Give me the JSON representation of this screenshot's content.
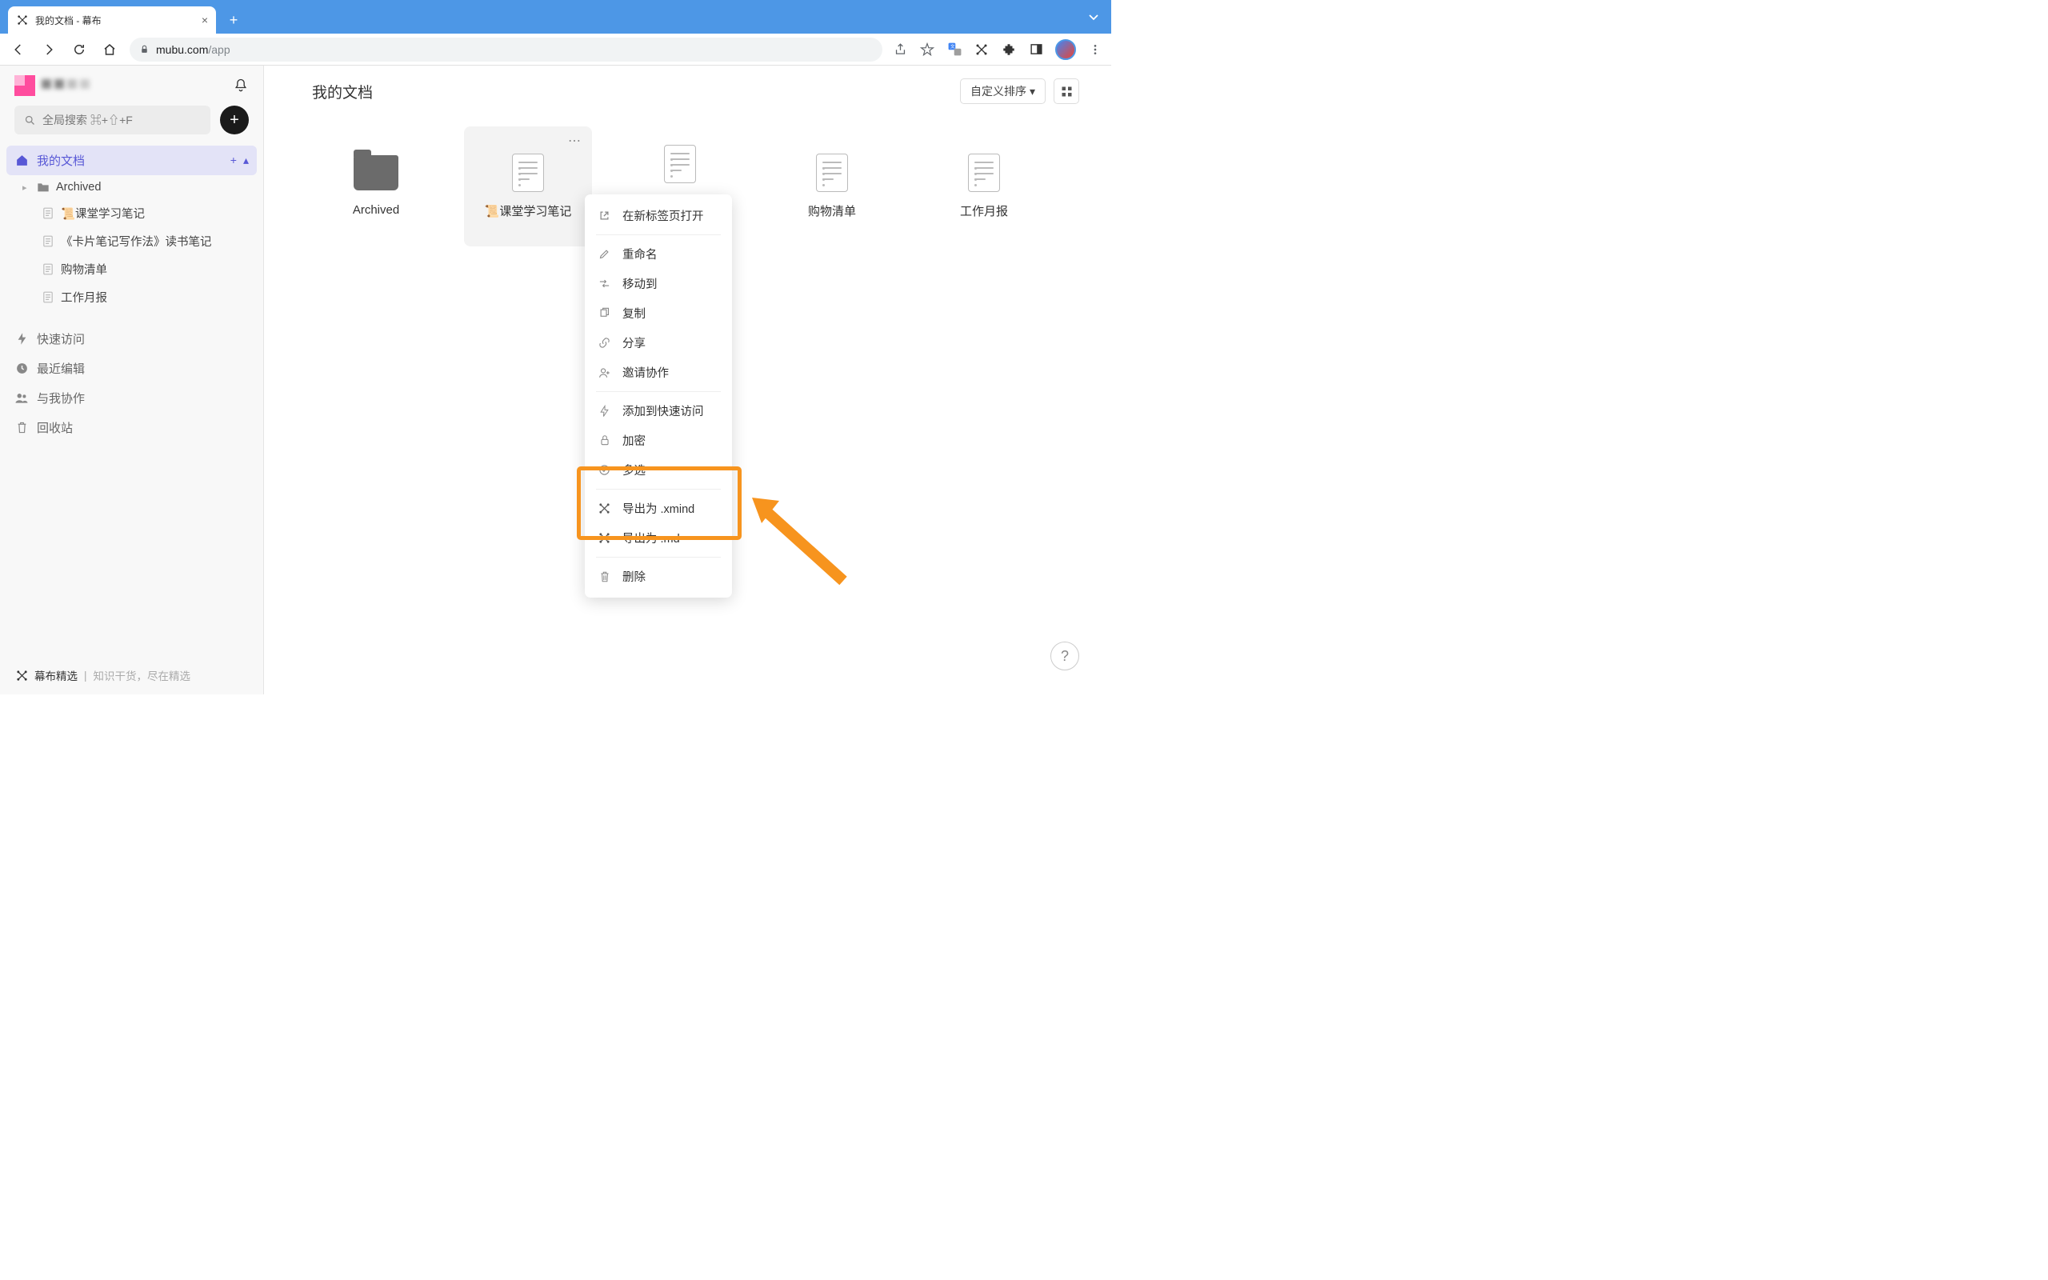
{
  "browser": {
    "tab_title": "我的文档 - 幕布",
    "url_domain": "mubu.com",
    "url_path": "/app"
  },
  "sidebar": {
    "search_placeholder": "全局搜索 ⌘+⇧+F",
    "my_docs": "我的文档",
    "tree": [
      {
        "label": "Archived",
        "type": "folder"
      },
      {
        "label": "📜课堂学习笔记",
        "type": "doc"
      },
      {
        "label": "《卡片笔记写作法》读书笔记",
        "type": "doc"
      },
      {
        "label": "购物清单",
        "type": "doc"
      },
      {
        "label": "工作月报",
        "type": "doc"
      }
    ],
    "nav": {
      "quick": "快速访问",
      "recent": "最近编辑",
      "shared": "与我协作",
      "trash": "回收站"
    },
    "footer_title": "幕布精选",
    "footer_sub": "知识干货，尽在精选"
  },
  "main": {
    "title": "我的文档",
    "sort_label": "自定义排序",
    "tiles": [
      {
        "label": "Archived",
        "kind": "folder"
      },
      {
        "label": "📜课堂学习笔记",
        "kind": "doc",
        "hovered": true
      },
      {
        "label": "《卡片笔记写作法》读书笔记",
        "kind": "doc"
      },
      {
        "label": "购物清单",
        "kind": "doc"
      },
      {
        "label": "工作月报",
        "kind": "doc"
      }
    ]
  },
  "context_menu": {
    "open_new_tab": "在新标签页打开",
    "rename": "重命名",
    "move_to": "移动到",
    "copy": "复制",
    "share": "分享",
    "invite": "邀请协作",
    "quick_access": "添加到快速访问",
    "encrypt": "加密",
    "multi_select": "多选",
    "export_xmind": "导出为 .xmind",
    "export_md": "导出为 .md",
    "delete": "删除"
  }
}
